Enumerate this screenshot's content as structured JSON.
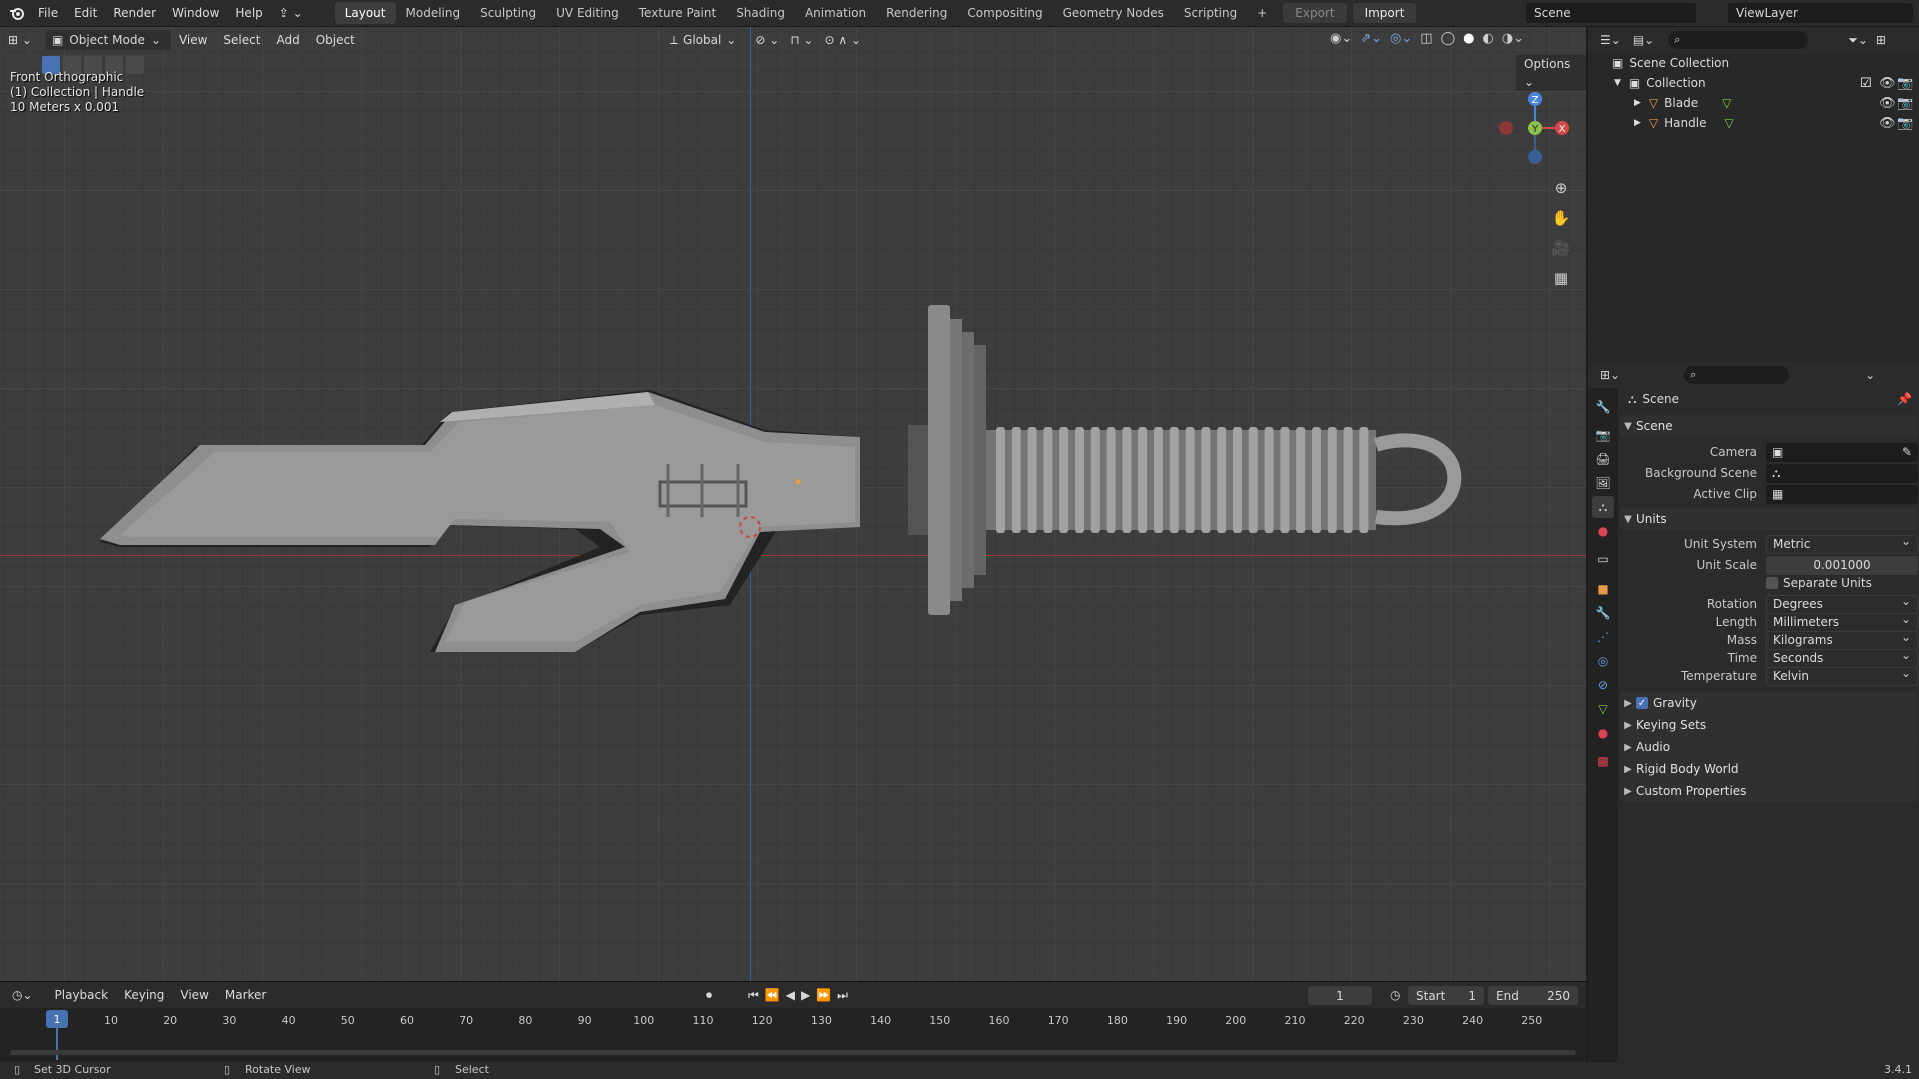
{
  "menubar": {
    "items": [
      "File",
      "Edit",
      "Render",
      "Window",
      "Help"
    ],
    "workspaces": [
      "Layout",
      "Modeling",
      "Sculpting",
      "UV Editing",
      "Texture Paint",
      "Shading",
      "Animation",
      "Rendering",
      "Compositing",
      "Geometry Nodes",
      "Scripting"
    ],
    "active_workspace": "Layout",
    "export_label": "Export",
    "import_label": "Import",
    "scene_name": "Scene",
    "view_layer": "ViewLayer"
  },
  "viewport": {
    "mode": "Object Mode",
    "menus": [
      "View",
      "Select",
      "Add",
      "Object"
    ],
    "orientation": "Global",
    "view_name": "Front Orthographic",
    "collection_info": "(1) Collection | Handle",
    "scale_info": "10 Meters x 0.001",
    "options_label": "Options",
    "gizmo_axes": {
      "z": "Z",
      "y": "Y",
      "x": "X"
    }
  },
  "outliner": {
    "root": "Scene Collection",
    "collection": "Collection",
    "objects": [
      "Blade",
      "Handle"
    ]
  },
  "properties": {
    "title": "Scene",
    "scene_panel": {
      "title": "Scene",
      "camera_label": "Camera",
      "background_label": "Background Scene",
      "clip_label": "Active Clip"
    },
    "units_panel": {
      "title": "Units",
      "unit_system_label": "Unit System",
      "unit_system": "Metric",
      "unit_scale_label": "Unit Scale",
      "unit_scale": "0.001000",
      "separate_units": "Separate Units",
      "rotation_label": "Rotation",
      "rotation": "Degrees",
      "length_label": "Length",
      "length": "Millimeters",
      "mass_label": "Mass",
      "mass": "Kilograms",
      "time_label": "Time",
      "time": "Seconds",
      "temperature_label": "Temperature",
      "temperature": "Kelvin"
    },
    "collapsed_panels": [
      "Gravity",
      "Keying Sets",
      "Audio",
      "Rigid Body World",
      "Custom Properties"
    ]
  },
  "timeline": {
    "menus": [
      "Playback",
      "Keying",
      "View",
      "Marker"
    ],
    "current_frame": "1",
    "start_label": "Start",
    "start": "1",
    "end_label": "End",
    "end": "250",
    "ticks": [
      "10",
      "20",
      "30",
      "40",
      "50",
      "60",
      "70",
      "80",
      "90",
      "100",
      "110",
      "120",
      "130",
      "140",
      "150",
      "160",
      "170",
      "180",
      "190",
      "200",
      "210",
      "220",
      "230",
      "240",
      "250"
    ],
    "playhead": "1"
  },
  "statusbar": {
    "hint1": "Set 3D Cursor",
    "hint2": "Rotate View",
    "hint3": "Select",
    "version": "3.4.1"
  },
  "colors": {
    "accent": "#4772b3",
    "x_axis": "#d44747",
    "y_axis": "#8bc34a",
    "z_axis": "#4a86d8",
    "object_orange": "#e8994a"
  }
}
